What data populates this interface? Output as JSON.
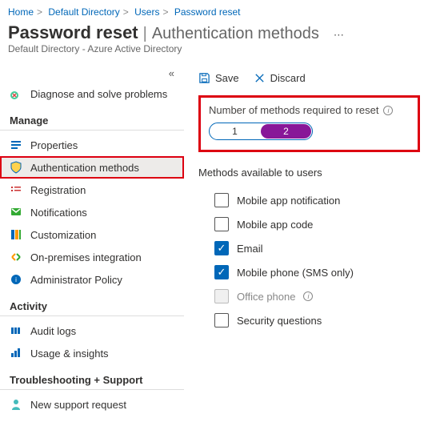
{
  "breadcrumb": {
    "home": "Home",
    "dir": "Default Directory",
    "users": "Users",
    "pw": "Password reset"
  },
  "title": {
    "main": "Password reset",
    "sub": "Authentication methods",
    "subtitle": "Default Directory - Azure Active Directory"
  },
  "sidebar": {
    "diagnose": "Diagnose and solve problems",
    "manage": "Manage",
    "items": {
      "properties": "Properties",
      "auth": "Authentication methods",
      "reg": "Registration",
      "notif": "Notifications",
      "custom": "Customization",
      "onprem": "On-premises integration",
      "admin": "Administrator Policy"
    },
    "activity": "Activity",
    "audit": "Audit logs",
    "usage": "Usage & insights",
    "trouble": "Troubleshooting + Support",
    "support": "New support request"
  },
  "toolbar": {
    "save": "Save",
    "discard": "Discard"
  },
  "numsection": {
    "title": "Number of methods required to reset",
    "opt1": "1",
    "opt2": "2",
    "selected": "2"
  },
  "methods": {
    "title": "Methods available to users",
    "list": {
      "app_notif": "Mobile app notification",
      "app_code": "Mobile app code",
      "email": "Email",
      "sms": "Mobile phone (SMS only)",
      "office": "Office phone",
      "secq": "Security questions"
    },
    "checked": [
      "email",
      "sms"
    ],
    "disabled": [
      "office"
    ]
  }
}
